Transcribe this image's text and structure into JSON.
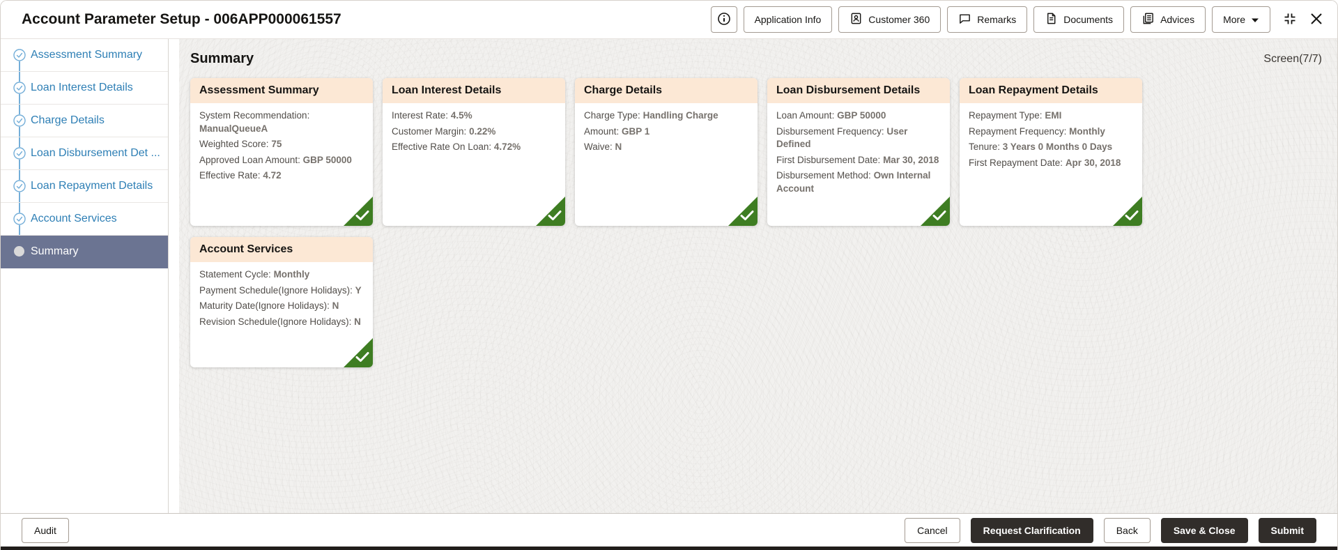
{
  "window": {
    "title": "Account Parameter Setup - 006APP000061557"
  },
  "toolbar": {
    "application_info": "Application Info",
    "customer_360": "Customer 360",
    "remarks": "Remarks",
    "documents": "Documents",
    "advices": "Advices",
    "more": "More"
  },
  "icons": {
    "info": "ⓘ",
    "customer_360": "badge-person",
    "remarks": "speech-bubble",
    "documents": "document",
    "advices": "document-stack",
    "more_caret": "▾",
    "collapse_window": "corner-brackets-inward",
    "close_window": "✕",
    "step_completed": "✓",
    "step_active": "●",
    "card_completed": "✓"
  },
  "sidebar": {
    "items": [
      {
        "label": "Assessment Summary",
        "status": "completed"
      },
      {
        "label": "Loan Interest Details",
        "status": "completed"
      },
      {
        "label": "Charge Details",
        "status": "completed"
      },
      {
        "label": "Loan Disbursement Det ...",
        "status": "completed"
      },
      {
        "label": "Loan Repayment Details",
        "status": "completed"
      },
      {
        "label": "Account Services",
        "status": "completed"
      },
      {
        "label": "Summary",
        "status": "active"
      }
    ]
  },
  "main": {
    "title": "Summary",
    "screen_indicator": "Screen(7/7)",
    "cards": [
      {
        "title": "Assessment Summary",
        "fields": [
          {
            "label": "System Recommendation:",
            "value": "ManualQueueA"
          },
          {
            "label": "Weighted Score:",
            "value": "75"
          },
          {
            "label": "Approved Loan Amount:",
            "value": "GBP 50000"
          },
          {
            "label": "Effective Rate:",
            "value": "4.72"
          }
        ]
      },
      {
        "title": "Loan Interest Details",
        "fields": [
          {
            "label": "Interest Rate:",
            "value": "4.5%"
          },
          {
            "label": "Customer Margin:",
            "value": "0.22%"
          },
          {
            "label": "Effective Rate On Loan:",
            "value": "4.72%"
          }
        ]
      },
      {
        "title": "Charge Details",
        "fields": [
          {
            "label": "Charge Type:",
            "value": "Handling Charge"
          },
          {
            "label": "Amount:",
            "value": "GBP 1"
          },
          {
            "label": "Waive:",
            "value": "N"
          }
        ]
      },
      {
        "title": "Loan Disbursement Details",
        "fields": [
          {
            "label": "Loan Amount:",
            "value": "GBP 50000"
          },
          {
            "label": "Disbursement Frequency:",
            "value": "User Defined"
          },
          {
            "label": "First Disbursement Date:",
            "value": "Mar 30, 2018"
          },
          {
            "label": "Disbursement Method:",
            "value": "Own Internal Account"
          }
        ]
      },
      {
        "title": "Loan Repayment Details",
        "fields": [
          {
            "label": "Repayment Type:",
            "value": "EMI"
          },
          {
            "label": "Repayment Frequency:",
            "value": "Monthly"
          },
          {
            "label": "Tenure:",
            "value": "3 Years 0 Months 0 Days"
          },
          {
            "label": "First Repayment Date:",
            "value": "Apr 30, 2018"
          }
        ]
      },
      {
        "title": "Account Services",
        "fields": [
          {
            "label": "Statement Cycle:",
            "value": "Monthly"
          },
          {
            "label": "Payment Schedule(Ignore Holidays):",
            "value": "Y"
          },
          {
            "label": "Maturity Date(Ignore Holidays):",
            "value": "N"
          },
          {
            "label": "Revision Schedule(Ignore Holidays):",
            "value": "N"
          }
        ]
      }
    ]
  },
  "footer": {
    "audit": "Audit",
    "cancel": "Cancel",
    "request_clarification": "Request Clarification",
    "back": "Back",
    "save_and_close": "Save & Close",
    "submit": "Submit"
  },
  "colors": {
    "card_header_bg": "#fce8d5",
    "completed_green": "#3e7d22",
    "sidebar_link": "#2e7fb5",
    "active_item_bg": "#6b7492",
    "dark_button_bg": "#312d2a"
  }
}
